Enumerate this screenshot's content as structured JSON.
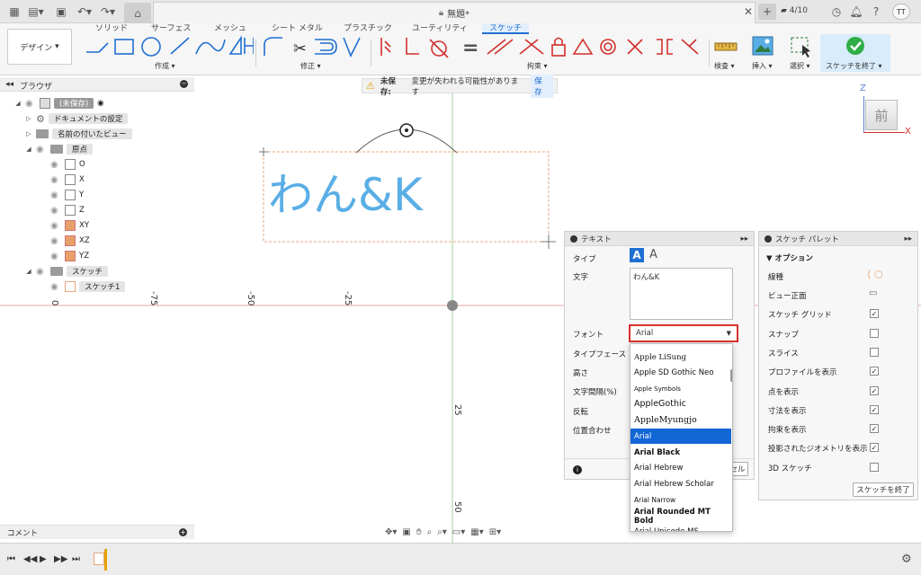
{
  "titlebar": {
    "doc_title": "無題*",
    "job_count": "4/10",
    "user_initials": "TT"
  },
  "ribbon": {
    "tabs": [
      "ソリッド",
      "サーフェス",
      "メッシュ",
      "シート メタル",
      "プラスチック",
      "ユーティリティ",
      "スケッチ"
    ],
    "active_tab": "スケッチ",
    "workspace": "デザイン",
    "groups": {
      "create": "作成",
      "modify": "修正",
      "constraints": "拘束",
      "inspect": "検査",
      "insert": "挿入",
      "select": "選択",
      "finish": "スケッチを終了"
    }
  },
  "warning": {
    "prefix": "未保存:",
    "message": "変更が失われる可能性があります",
    "save_label": "保存"
  },
  "browser": {
    "title": "ブラウザ",
    "root": "(未保存)",
    "items": [
      {
        "label": "ドキュメントの設定"
      },
      {
        "label": "名前の付いたビュー"
      },
      {
        "label": "原点"
      },
      {
        "label": "O"
      },
      {
        "label": "X"
      },
      {
        "label": "Y"
      },
      {
        "label": "Z"
      },
      {
        "label": "XY"
      },
      {
        "label": "XZ"
      },
      {
        "label": "YZ"
      },
      {
        "label": "スケッチ"
      },
      {
        "label": "スケッチ1"
      }
    ]
  },
  "canvas": {
    "sketch_text": "わん&K",
    "view_label": "前",
    "axis_z": "Z",
    "axis_x": "X",
    "rulers_h": [
      "-75",
      "-50",
      "-25"
    ],
    "rulers_v": [
      "25",
      "50"
    ]
  },
  "text_panel": {
    "title": "テキスト",
    "labels": {
      "type": "タイプ",
      "text": "文字",
      "font": "フォント",
      "typeface": "タイプフェース",
      "height": "高さ",
      "spacing": "文字間隔(%)",
      "flip": "反転",
      "align": "位置合わせ"
    },
    "text_value": "わん&K",
    "font_value": "Arial",
    "cancel_fragment": "セル",
    "font_options": [
      "Apple LiSung",
      "Apple SD Gothic Neo",
      "Apple Symbols",
      "AppleGothic",
      "AppleMyungjo",
      "Arial",
      "Arial Black",
      "Arial Hebrew",
      "Arial Hebrew Scholar",
      "Arial Narrow",
      "Arial Rounded MT Bold",
      "Arial Unicode MS"
    ],
    "selected_font_index": 5
  },
  "palette": {
    "title": "スケッチ パレット",
    "section": "オプション",
    "options": [
      {
        "label": "線種",
        "checked": null
      },
      {
        "label": "ビュー正面",
        "checked": null
      },
      {
        "label": "スケッチ グリッド",
        "checked": true
      },
      {
        "label": "スナップ",
        "checked": false
      },
      {
        "label": "スライス",
        "checked": false
      },
      {
        "label": "プロファイルを表示",
        "checked": true
      },
      {
        "label": "点を表示",
        "checked": true
      },
      {
        "label": "寸法を表示",
        "checked": true
      },
      {
        "label": "拘束を表示",
        "checked": true
      },
      {
        "label": "投影されたジオメトリを表示",
        "checked": true
      },
      {
        "label": "3D スケッチ",
        "checked": false
      }
    ],
    "finish_label": "スケッチを終了"
  },
  "comment": {
    "title": "コメント"
  },
  "colors": {
    "accent": "#1f6fd1",
    "sketch_text": "#5aaee6",
    "constraint_red": "#d0302c",
    "finish_green": "#2fae47"
  }
}
